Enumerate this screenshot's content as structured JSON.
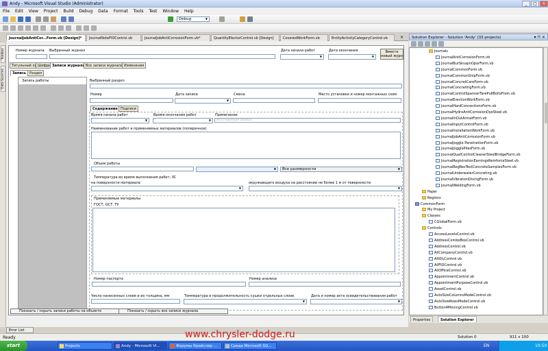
{
  "window": {
    "title": "Andy - Microsoft Visual Studio (Administrator)"
  },
  "menu": [
    "File",
    "Edit",
    "View",
    "Project",
    "Build",
    "Debug",
    "Data",
    "Format",
    "Tools",
    "Test",
    "Window",
    "Help"
  ],
  "toolbar": {
    "config": "Debug"
  },
  "side_tabs": [
    "Toolbox",
    "Data Sources"
  ],
  "doc_tabs": [
    "JournalJobAntiCor...Form.vb [Design]*",
    "JournalNoteFIOControl.vb",
    "JournalJobAntiCorrosionForm.vb*",
    "QuantityElectorControl.vb [Design]",
    "CoveredWorkForm.vb",
    "EntityActivityCategoryControl.vb"
  ],
  "form": {
    "journal_number_label": "Номер журнала",
    "selected_journal_label": "Выбранный журнал",
    "start_date_label": "Дата начала работ",
    "end_date_label": "Дата окончания",
    "insert_button": "Вместо новый журн",
    "top_tabs": [
      "Титульный лист",
      "Шифры",
      "Записи журнала",
      "Все записи журнала",
      "Изменения"
    ],
    "entry_tabs": [
      "Запись",
      "Раздел"
    ],
    "entry_list_item": "Запись работы",
    "selected_section_label": "Выбранный раздел",
    "number_label": "Номер",
    "record_date_label": "Дата записи",
    "shift_label": "Смена",
    "place_label": "Место установки и номер монтажных схем",
    "content_tabs": [
      "Содержание",
      "Подписи"
    ],
    "work_start_label": "Время начала работ",
    "work_end_label": "Время окончания работ",
    "note_label": "Примечание",
    "note_placeholder": "Изготовление записи",
    "work_name_label": "Наименование работ и применяемых материалов (поперечное)",
    "volume_label": "Объем работы",
    "all_dimensions": "Все размерности",
    "temp_label": "Температура во время выполнения работ, 0С",
    "surface_label": "на поверхности материала",
    "air_label": "окружающего воздуха на расстоянии не более 1 м от поверхности",
    "materials_label": "Применяемые материалы",
    "gost_label": "ГОСТ, ОСТ, ТУ",
    "passport_label": "Номер паспорта",
    "analysis_label": "Номер анализа",
    "layers_label": "Число нанесенных слоев и их толщина, мм",
    "drying_label": "Температура и продолжительность сушки отдельных слоев",
    "act_label": "Дата и номер акта освидетельствования работ",
    "show_object_label": "Показать / скрыть записи работы на объекте",
    "show_all_label": "Показать / скрыть все записи журнала"
  },
  "solution": {
    "header": "Solution Explorer - Solution 'Andy' (33 projects)",
    "journals_folder": "Journals",
    "journal_files": [
      "JournalAntiCorrosionForm.vb",
      "JournalBurSkvajinOporForm.vb",
      "JournalCommonForm.vb",
      "JournalCommonSnipForm.vb",
      "JournalConcretCareForm.vb",
      "JournalConcretingForm.vb",
      "JournalControlSpannerTarePullBoltsFrom.vb",
      "JournalErectionWorkForm.vb",
      "JournalHardConnectionsForm.vb",
      "JournalHydroAntiCorrosionDyeSteel.vb",
      "JournalInOutArmatForm.vb",
      "JournalInputControlForm.vb",
      "JournalInstallationWorkForm.vb",
      "JournalJobAntiCorrosionForm.vb",
      "JournalJoggle PenetrationForm.vb",
      "JournalJogglePilesForm.vb",
      "JournalQualControlCleanerSteelBridgeForm.vb",
      "JournalRegistrationEarningsReinforceSteel.vb",
      "JournalRegRezTestConcreteSamplesForm.vb",
      "JournalUnderwaterConcreting.vb",
      "JournalVibrationDivingForm.vb",
      "JournalWeldingForm.vb"
    ],
    "other_items": [
      {
        "name": "Paper",
        "kind": "folder",
        "indent": 1
      },
      {
        "name": "Regions",
        "kind": "folder",
        "indent": 1
      },
      {
        "name": "CommonForm",
        "kind": "proj",
        "indent": 0
      },
      {
        "name": "My Project",
        "kind": "folder",
        "indent": 1
      },
      {
        "name": "Classes",
        "kind": "folder",
        "indent": 1
      },
      {
        "name": "CGlobalForm.vb",
        "kind": "file",
        "indent": 2
      },
      {
        "name": "Controls",
        "kind": "folder",
        "indent": 1
      },
      {
        "name": "AccessLevelsControl.vb",
        "kind": "file",
        "indent": 2
      },
      {
        "name": "AddressComboBoxControl.vb",
        "kind": "file",
        "indent": 2
      },
      {
        "name": "AddressControl.vb",
        "kind": "file",
        "indent": 2
      },
      {
        "name": "AllCompanyControl.vb",
        "kind": "file",
        "indent": 2
      },
      {
        "name": "AllIDLControl.vb",
        "kind": "file",
        "indent": 2
      },
      {
        "name": "AllFIOControl.vb",
        "kind": "file",
        "indent": 2
      },
      {
        "name": "AllOfficeControl.vb",
        "kind": "file",
        "indent": 2
      },
      {
        "name": "AppointmentControl.vb",
        "kind": "file",
        "indent": 2
      },
      {
        "name": "AppointmentPurposeControl.vb",
        "kind": "file",
        "indent": 2
      },
      {
        "name": "AssetControl.vb",
        "kind": "file",
        "indent": 2
      },
      {
        "name": "AutoSizeColumnsModeControl.vb",
        "kind": "file",
        "indent": 2
      },
      {
        "name": "AutoSizeRowsModeControl.vb",
        "kind": "file",
        "indent": 2
      },
      {
        "name": "Button4MovingControl.vb",
        "kind": "file",
        "indent": 2
      }
    ],
    "bottom_tabs": [
      "Properties",
      "Solution Explorer"
    ]
  },
  "error_list": "Error List",
  "status": {
    "ready": "Ready",
    "solution": "Solution 0",
    "size": "911 x 100"
  },
  "taskbar": {
    "start": "start",
    "tasks": [
      "Projects",
      "Andy - Microsoft Vi...",
      "Форумы Крайслер ...",
      "Среда Microsoft SQ..."
    ],
    "lang": "EN",
    "clock": "10:50"
  },
  "watermark": "www.chrysler-dodge.ru"
}
